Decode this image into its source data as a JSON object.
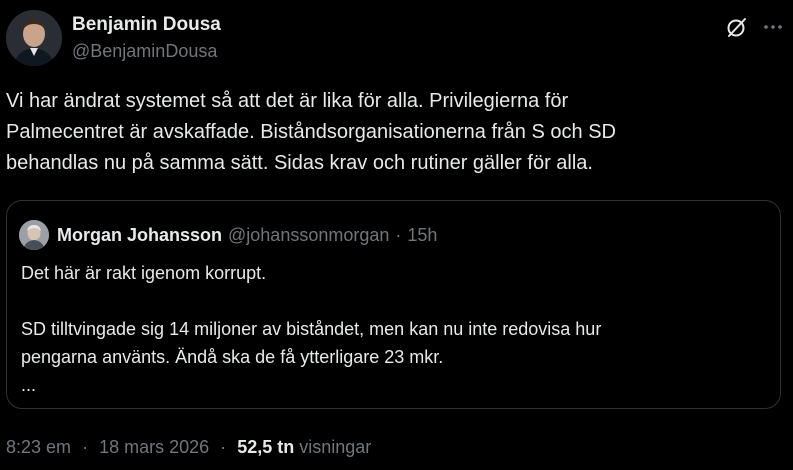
{
  "author": {
    "display_name": "Benjamin Dousa",
    "handle": "@BenjaminDousa"
  },
  "tweet_text": "Vi har ändrat systemet så att det är lika för alla. Privilegierna för\nPalmecentret är avskaffade. Biståndsorganisationerna från S och SD\nbehandlas nu på samma sätt. Sidas krav och rutiner gäller för alla.",
  "quoted": {
    "display_name": "Morgan Johansson",
    "handle": "@johanssonmorgan",
    "separator": "·",
    "time": "15h",
    "lines": [
      "Det här är rakt igenom korrupt.",
      "",
      "SD tilltvingade sig 14 miljoner av biståndet, men kan nu inte redovisa hur",
      "pengarna använts. Ändå ska de få ytterligare 23 mkr.",
      "..."
    ]
  },
  "meta": {
    "time": "8:23 em",
    "separator": "·",
    "date": "18 mars 2026",
    "views_count": "52,5 tn",
    "views_label": "visningar"
  },
  "icons": {
    "grok": "grok-icon",
    "more": "more-icon"
  },
  "colors": {
    "background": "#000000",
    "text": "#e7e9ea",
    "muted": "#71767b",
    "border": "#2f3336"
  }
}
